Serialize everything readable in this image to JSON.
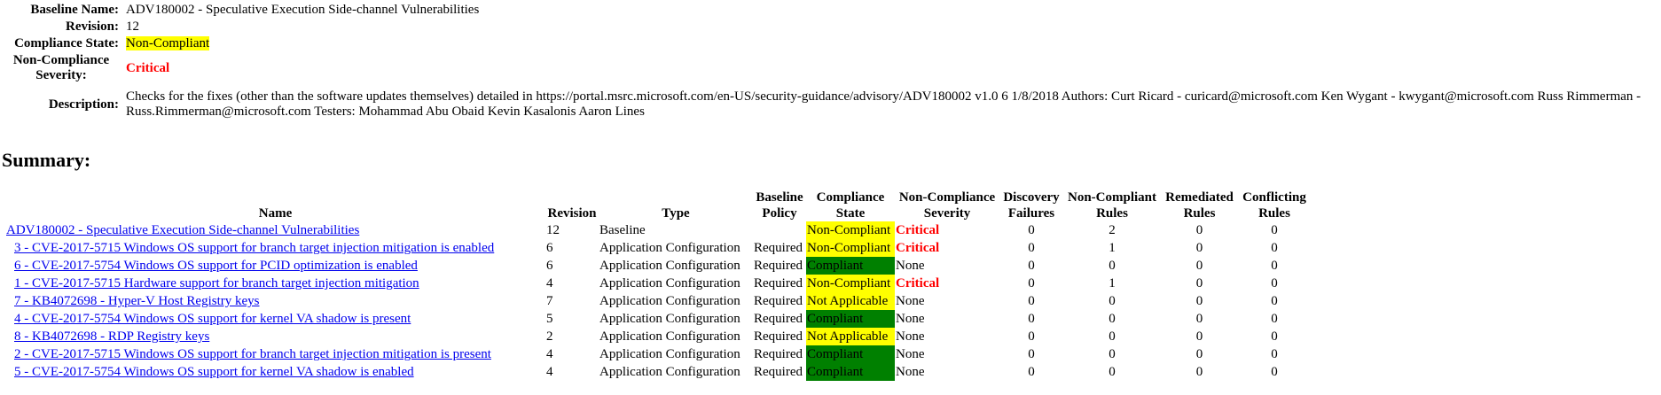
{
  "details": {
    "baseline_name_label": "Baseline Name:",
    "baseline_name": "ADV180002 - Speculative Execution Side-channel Vulnerabilities",
    "revision_label": "Revision:",
    "revision": "12",
    "compliance_state_label": "Compliance State:",
    "compliance_state": "Non-Compliant",
    "severity_label_line1": "Non-Compliance",
    "severity_label_line2": "Severity:",
    "severity": "Critical",
    "description_label": "Description:",
    "description": "Checks for the fixes (other than the software updates themselves) detailed in https://portal.msrc.microsoft.com/en-US/security-guidance/advisory/ADV180002 v1.0 6 1/8/2018 Authors: Curt Ricard - curicard@microsoft.com Ken Wygant - kwygant@microsoft.com Russ Rimmerman - Russ.Rimmerman@microsoft.com Testers: Mohammad Abu Obaid Kevin Kasalonis Aaron Lines"
  },
  "summary": {
    "title": "Summary:",
    "headers": {
      "name": "Name",
      "revision": "Revision",
      "type": "Type",
      "baseline_policy_1": "Baseline",
      "baseline_policy_2": "Policy",
      "compliance_state_1": "Compliance",
      "compliance_state_2": "State",
      "severity_1": "Non-Compliance",
      "severity_2": "Severity",
      "discovery_failures_1": "Discovery",
      "discovery_failures_2": "Failures",
      "noncompliant_rules_1": "Non-Compliant",
      "noncompliant_rules_2": "Rules",
      "remediated_rules_1": "Remediated",
      "remediated_rules_2": "Rules",
      "conflicting_rules_1": "Conflicting",
      "conflicting_rules_2": "Rules"
    },
    "rows": [
      {
        "name": "ADV180002 - Speculative Execution Side-channel Vulnerabilities",
        "indent": false,
        "revision": "12",
        "type": "Baseline",
        "policy": "",
        "state": "Non-Compliant",
        "state_class": "st-noncompliant",
        "severity": "Critical",
        "severity_class": "sev-critical",
        "discovery_failures": "0",
        "noncompliant_rules": "2",
        "remediated_rules": "0",
        "conflicting_rules": "0"
      },
      {
        "name": "3 - CVE-2017-5715 Windows OS support for branch target injection mitigation is enabled",
        "indent": true,
        "revision": "6",
        "type": "Application Configuration",
        "policy": "Required",
        "state": "Non-Compliant",
        "state_class": "st-noncompliant",
        "severity": "Critical",
        "severity_class": "sev-critical",
        "discovery_failures": "0",
        "noncompliant_rules": "1",
        "remediated_rules": "0",
        "conflicting_rules": "0"
      },
      {
        "name": "6 - CVE-2017-5754 Windows OS support for PCID optimization is enabled",
        "indent": true,
        "revision": "6",
        "type": "Application Configuration",
        "policy": "Required",
        "state": "Compliant",
        "state_class": "st-compliant",
        "severity": "None",
        "severity_class": "",
        "discovery_failures": "0",
        "noncompliant_rules": "0",
        "remediated_rules": "0",
        "conflicting_rules": "0"
      },
      {
        "name": "1 - CVE-2017-5715 Hardware support for branch target injection mitigation",
        "indent": true,
        "revision": "4",
        "type": "Application Configuration",
        "policy": "Required",
        "state": "Non-Compliant",
        "state_class": "st-noncompliant",
        "severity": "Critical",
        "severity_class": "sev-critical",
        "discovery_failures": "0",
        "noncompliant_rules": "1",
        "remediated_rules": "0",
        "conflicting_rules": "0"
      },
      {
        "name": "7 - KB4072698 - Hyper-V Host Registry keys",
        "indent": true,
        "revision": "7",
        "type": "Application Configuration",
        "policy": "Required",
        "state": "Not Applicable",
        "state_class": "st-notapplicable",
        "severity": "None",
        "severity_class": "",
        "discovery_failures": "0",
        "noncompliant_rules": "0",
        "remediated_rules": "0",
        "conflicting_rules": "0"
      },
      {
        "name": "4 - CVE-2017-5754 Windows OS support for kernel VA shadow is present",
        "indent": true,
        "revision": "5",
        "type": "Application Configuration",
        "policy": "Required",
        "state": "Compliant",
        "state_class": "st-compliant",
        "severity": "None",
        "severity_class": "",
        "discovery_failures": "0",
        "noncompliant_rules": "0",
        "remediated_rules": "0",
        "conflicting_rules": "0"
      },
      {
        "name": "8 - KB4072698 - RDP Registry keys",
        "indent": true,
        "revision": "2",
        "type": "Application Configuration",
        "policy": "Required",
        "state": "Not Applicable",
        "state_class": "st-notapplicable",
        "severity": "None",
        "severity_class": "",
        "discovery_failures": "0",
        "noncompliant_rules": "0",
        "remediated_rules": "0",
        "conflicting_rules": "0"
      },
      {
        "name": "2 - CVE-2017-5715 Windows OS support for branch target injection mitigation is present",
        "indent": true,
        "revision": "4",
        "type": "Application Configuration",
        "policy": "Required",
        "state": "Compliant",
        "state_class": "st-compliant",
        "severity": "None",
        "severity_class": "",
        "discovery_failures": "0",
        "noncompliant_rules": "0",
        "remediated_rules": "0",
        "conflicting_rules": "0"
      },
      {
        "name": "5 - CVE-2017-5754 Windows OS support for kernel VA shadow is enabled",
        "indent": true,
        "revision": "4",
        "type": "Application Configuration",
        "policy": "Required",
        "state": "Compliant",
        "state_class": "st-compliant",
        "severity": "None",
        "severity_class": "",
        "discovery_failures": "0",
        "noncompliant_rules": "0",
        "remediated_rules": "0",
        "conflicting_rules": "0"
      }
    ]
  }
}
